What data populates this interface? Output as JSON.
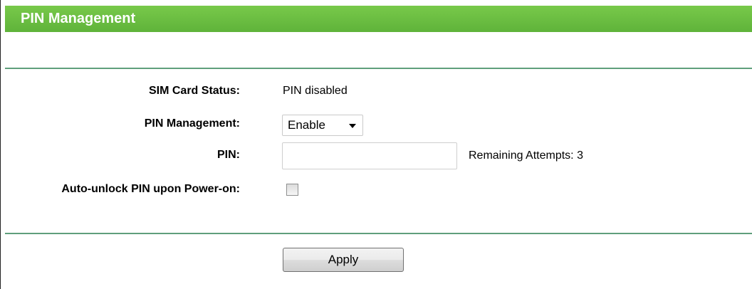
{
  "header": {
    "title": "PIN Management"
  },
  "form": {
    "sim_status": {
      "label": "SIM Card Status:",
      "value": "PIN disabled"
    },
    "pin_management": {
      "label": "PIN Management:",
      "selected": "Enable"
    },
    "pin": {
      "label": "PIN:",
      "value": "",
      "remaining_label": "Remaining Attempts:",
      "remaining_count": "3"
    },
    "auto_unlock": {
      "label": "Auto-unlock PIN upon Power-on:",
      "checked": false
    }
  },
  "actions": {
    "apply_label": "Apply"
  }
}
